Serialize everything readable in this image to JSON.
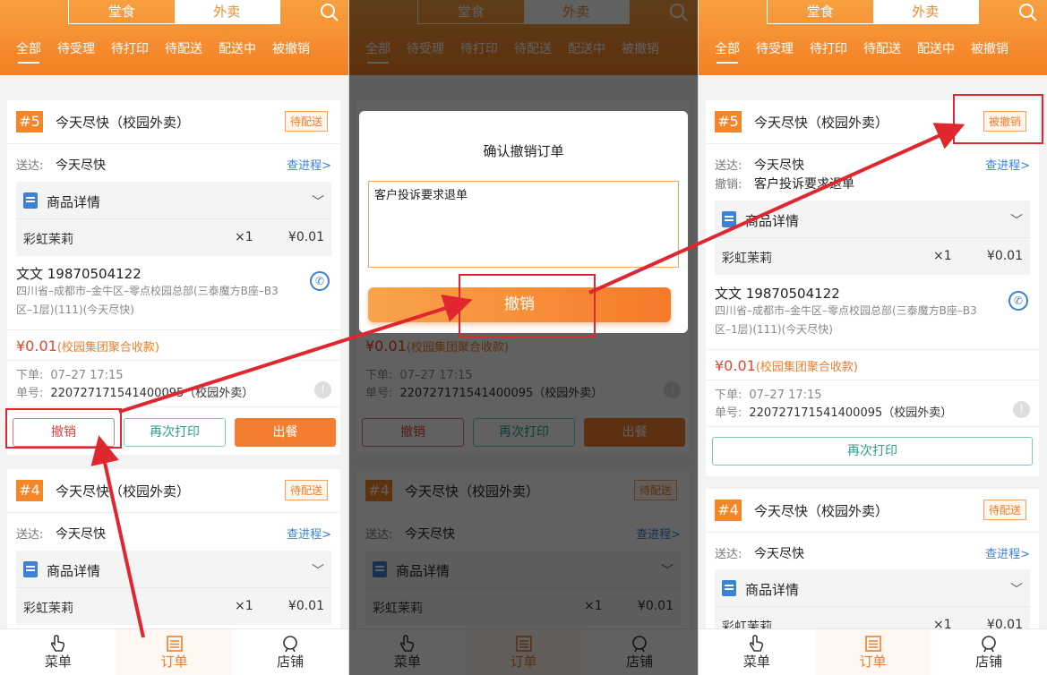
{
  "header": {
    "seg_dine": "堂食",
    "seg_takeout": "外卖",
    "tabs": [
      "全部",
      "待受理",
      "待打印",
      "待配送",
      "配送中",
      "被撤销"
    ]
  },
  "order5": {
    "num": "#5",
    "title": "今天尽快（校园外卖）",
    "status": "待配送",
    "status_cancelled": "被撤销",
    "deliver_label": "送达:",
    "deliver_value": "今天尽快",
    "progress_link": "查进程>",
    "cancel_label": "撤销:",
    "cancel_reason": "客户投诉要求退单",
    "goods_title": "商品详情",
    "item_name": "彩虹茉莉",
    "item_qty": "×1",
    "item_price": "¥0.01",
    "contact": "文文 19870504122",
    "address_line1": "四川省–成都市–金牛区–零点校园总部(三泰魔方B座–B3",
    "address_line2": "区–1层)(111)(今天尽快)",
    "price": "¥0.01",
    "price_note": "(校园集团聚合收款)",
    "order_label": "下单:",
    "order_time": "07–27 17:15",
    "no_label": "单号:",
    "order_no": "220727171541400095（校园外卖）"
  },
  "order4": {
    "num": "#4",
    "title": "今天尽快（校园外卖）",
    "status": "待配送",
    "deliver_label": "送达:",
    "deliver_value": "今天尽快",
    "progress_link": "查进程>",
    "goods_title": "商品详情",
    "item_name": "彩虹茉莉",
    "item_qty": "×1",
    "item_price": "¥0.01"
  },
  "buttons": {
    "cancel": "撤销",
    "reprint": "再次打印",
    "serve": "出餐"
  },
  "dialog": {
    "title": "确认撤销订单",
    "reason": "客户投诉要求退单",
    "confirm": "撤销"
  },
  "bottom_nav": [
    "菜单",
    "订单",
    "店铺"
  ],
  "colors": {
    "accent": "#f47e30",
    "annotation_red": "#e0262e"
  }
}
